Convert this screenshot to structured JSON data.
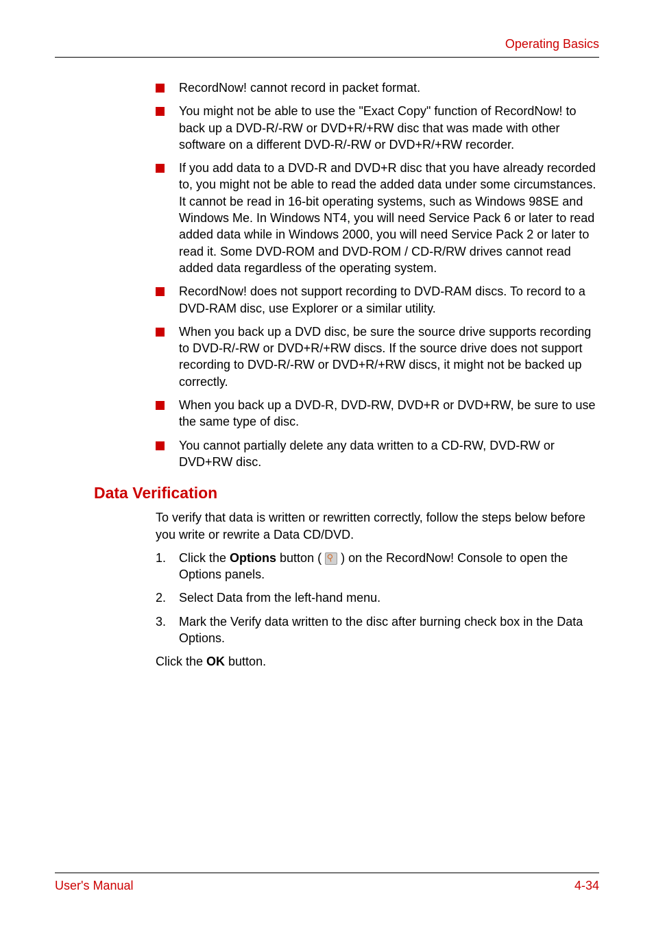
{
  "header": {
    "title": "Operating Basics"
  },
  "bullets": [
    "RecordNow! cannot record in packet format.",
    "You might not be able to use the \"Exact Copy\" function of RecordNow! to back up a DVD-R/-RW or DVD+R/+RW disc that was made with other software on a different DVD-R/-RW or DVD+R/+RW recorder.",
    "If you add data to a DVD-R and DVD+R disc that you have already recorded to, you might not be able to read the added data under some circumstances. It cannot be read in 16-bit operating systems, such as Windows 98SE and Windows Me. In Windows NT4, you will need Service Pack 6 or later to read added data while in Windows 2000, you will need Service Pack 2 or later to read it. Some DVD-ROM and DVD-ROM / CD-R/RW drives cannot read added data regardless of the operating system.",
    "RecordNow! does not support recording to DVD-RAM discs. To record to a DVD-RAM disc, use Explorer or a similar utility.",
    "When you back up a DVD disc, be sure the source drive supports recording to DVD-R/-RW or DVD+R/+RW discs. If the source drive does not support recording to DVD-R/-RW or DVD+R/+RW discs, it might not be backed up correctly.",
    "When you back up a DVD-R, DVD-RW, DVD+R or DVD+RW, be sure to use the same type of disc.",
    "You cannot partially delete any data written to a CD-RW, DVD-RW or DVD+RW disc."
  ],
  "section": {
    "heading": "Data Verification",
    "intro": "To verify that data is written or rewritten correctly, follow the steps below before you write or rewrite a Data CD/DVD.",
    "steps": {
      "step1_prefix": "Click the ",
      "step1_bold": "Options",
      "step1_mid": " button ( ",
      "step1_suffix": " ) on the RecordNow! Console to open the Options panels.",
      "step2": "Select Data from the left-hand menu.",
      "step3": "Mark the Verify data written to the disc after burning check box in the Data Options."
    },
    "closing_prefix": "Click the ",
    "closing_bold": "OK",
    "closing_suffix": " button."
  },
  "footer": {
    "left": "User's Manual",
    "right": "4-34"
  }
}
